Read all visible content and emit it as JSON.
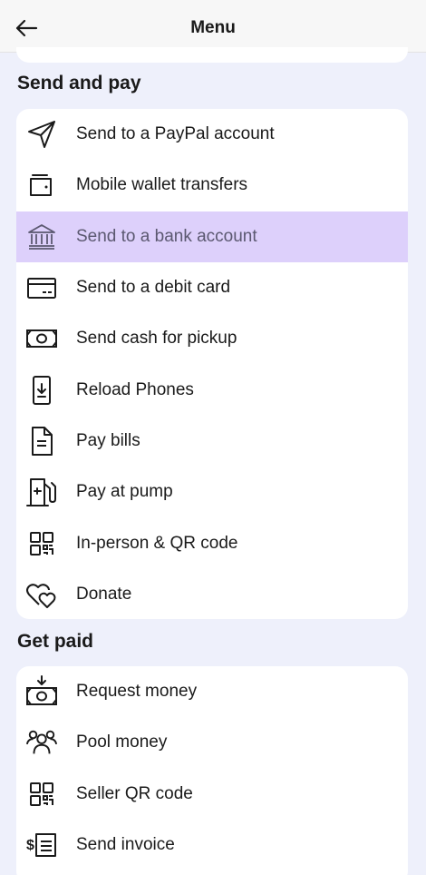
{
  "header": {
    "title": "Menu"
  },
  "sections": [
    {
      "heading": "Send and pay",
      "items": [
        {
          "label": "Send to a PayPal account",
          "icon": "paper-plane-icon"
        },
        {
          "label": "Mobile wallet transfers",
          "icon": "wallet-icon"
        },
        {
          "label": "Send to a bank account",
          "icon": "bank-icon",
          "selected": true
        },
        {
          "label": "Send to a debit card",
          "icon": "debit-card-icon"
        },
        {
          "label": "Send cash for pickup",
          "icon": "cash-icon"
        },
        {
          "label": "Reload Phones",
          "icon": "phone-reload-icon"
        },
        {
          "label": "Pay bills",
          "icon": "bill-document-icon"
        },
        {
          "label": "Pay at pump",
          "icon": "gas-pump-icon"
        },
        {
          "label": "In-person & QR code",
          "icon": "qr-code-icon"
        },
        {
          "label": "Donate",
          "icon": "hearts-icon"
        }
      ]
    },
    {
      "heading": "Get paid",
      "items": [
        {
          "label": "Request money",
          "icon": "request-cash-icon"
        },
        {
          "label": "Pool money",
          "icon": "group-people-icon"
        },
        {
          "label": "Seller QR code",
          "icon": "qr-code-icon"
        },
        {
          "label": "Send invoice",
          "icon": "invoice-icon"
        }
      ]
    }
  ],
  "colors": {
    "background": "#eef0fb",
    "selected": "#ddd0fb",
    "card": "#ffffff"
  }
}
